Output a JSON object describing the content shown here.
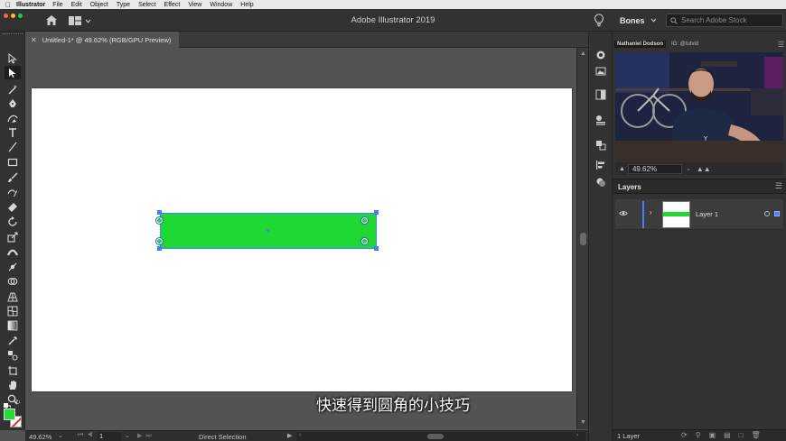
{
  "menubar": {
    "app": "Illustrator",
    "items": [
      "File",
      "Edit",
      "Object",
      "Type",
      "Select",
      "Effect",
      "View",
      "Window",
      "Help"
    ]
  },
  "appbar": {
    "title": "Adobe Illustrator 2019",
    "workspace": "Bones",
    "search_placeholder": "Search Adobe Stock"
  },
  "document": {
    "tab_title": "Untitled-1* @ 49.62% (RGB/GPU Preview)"
  },
  "colors": {
    "fill": "#1fd834",
    "selection": "#4b7bff",
    "stroke": "#ffffff"
  },
  "subtitle": "快速得到圆角的小技巧",
  "statusbar": {
    "zoom": "49.62%",
    "artboard": "1",
    "tool": "Direct Selection"
  },
  "webcam": {
    "name": "Nathaniel Dodson",
    "handle": "IG: @tutvid"
  },
  "navigator": {
    "zoom": "49.62%"
  },
  "layers": {
    "tab": "Layers",
    "items": [
      {
        "name": "Layer 1"
      }
    ],
    "count": "1 Layer"
  },
  "tools": [
    "selection-tool",
    "direct-selection-tool",
    "magic-wand-tool",
    "pen-tool",
    "curvature-tool",
    "type-tool",
    "line-tool",
    "rectangle-tool",
    "paintbrush-tool",
    "shaper-tool",
    "eraser-tool",
    "rotate-tool",
    "scale-tool",
    "width-tool",
    "puppet-warp-tool",
    "shape-builder-tool",
    "perspective-grid-tool",
    "mesh-tool",
    "gradient-tool",
    "eyedropper-tool",
    "blend-tool",
    "artboard-tool",
    "hand-tool",
    "zoom-tool"
  ]
}
